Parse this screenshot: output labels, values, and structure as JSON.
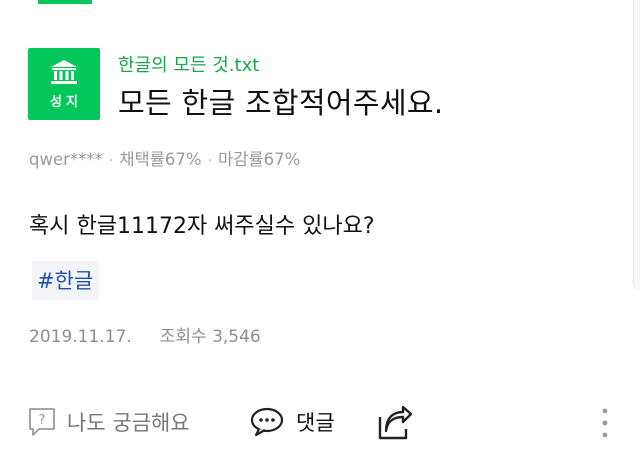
{
  "badge": {
    "label": "성지"
  },
  "post": {
    "source": "한글의 모든 것.txt",
    "title": "모든 한글 조합적어주세요.",
    "author": "qwer****",
    "adoption_rate": "채택률67%",
    "deadline_rate": "마감률67%",
    "body": "혹시 한글11172자 써주실수 있나요?",
    "tag": "#한글",
    "date": "2019.11.17.",
    "views": "조회수 3,546"
  },
  "actions": {
    "me_too": "나도 궁금해요",
    "comment": "댓글"
  },
  "colors": {
    "accent": "#03c75a",
    "tag_text": "#1f4fb0"
  }
}
